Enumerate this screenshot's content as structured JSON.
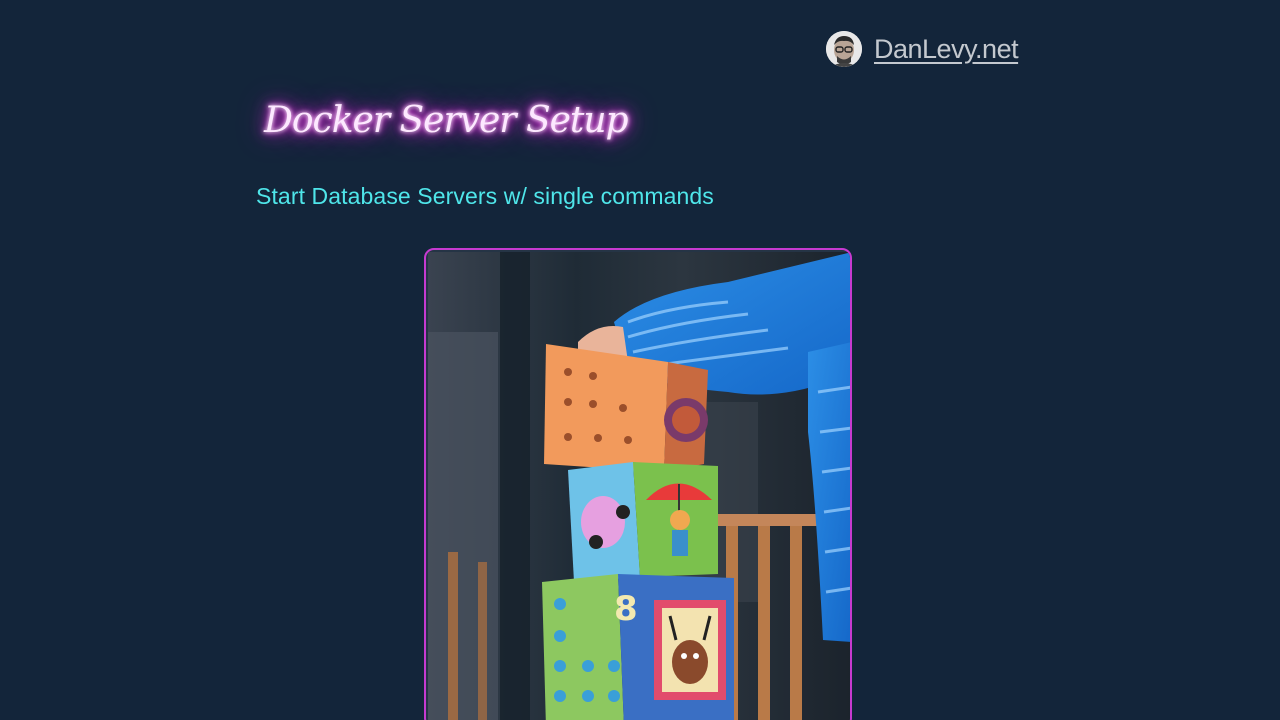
{
  "header": {
    "site_name": "DanLevy.net",
    "avatar_icon": "avatar-portrait-icon"
  },
  "post": {
    "title": "Docker Server Setup",
    "subtitle": "Start Database Servers w/ single commands",
    "hero_image": "child-stacking-toy-blocks-photo"
  },
  "colors": {
    "background": "#13253a",
    "title_glow": "#e22de0",
    "subtitle": "#4fe6ea",
    "link": "#c4c9cf",
    "frame_border": "#c63ad0"
  }
}
